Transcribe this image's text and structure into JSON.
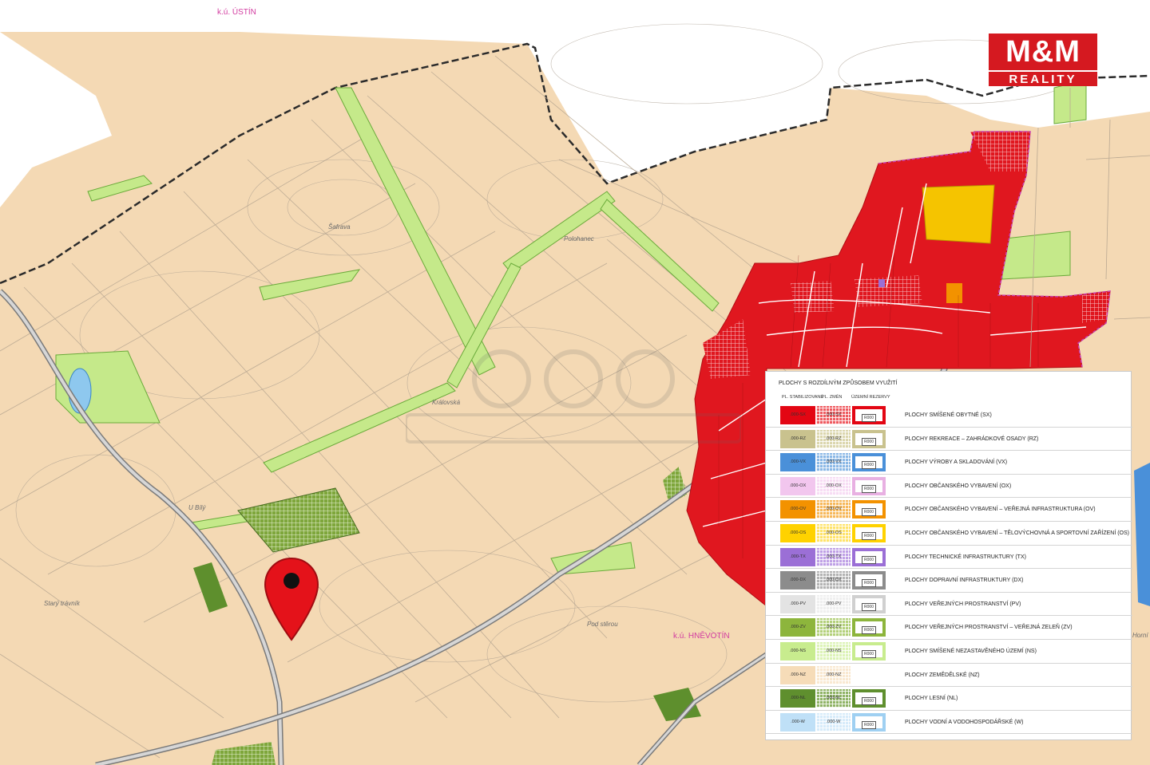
{
  "map": {
    "cadastral_labels": {
      "ustin": "k.ú. ÚSTÍN",
      "hnevotin": "k.ú. HNĚVOTÍN"
    },
    "place_names": {
      "sahrava": "Šafrava",
      "polohanec": "Polohanec",
      "kralovska": "Královská",
      "u_bily": "U Bílý",
      "stary_travnik": "Starý trávník",
      "pod_sterou": "Pod stěrou",
      "horni": "Horní"
    },
    "colors": {
      "agricultural": "#f4d9b4",
      "mixed_residential": "#e0171f",
      "greenery": "#c5e98a",
      "forest": "#5e8f2d",
      "boundary": "#2b2b2b",
      "road": "#8a8a8a"
    }
  },
  "logo": {
    "line1": "M&M",
    "line2": "REALITY",
    "color": "#d51920"
  },
  "marker": {
    "icon": "location-pin-icon",
    "color": "#e4121a"
  },
  "legend": {
    "title": "PLOCHY S ROZDÍLNÝM ZPŮSOBEM VYUŽITÍ",
    "col_stabilized": "PL. STABILIZOVANÉ",
    "col_change": "PL. ZMĚN",
    "col_reserve": "ÚZEMNÍ REZERVY",
    "rows": [
      {
        "code1": ".000-SX",
        "code2": ".000-SX",
        "reserve": "R000",
        "label": "PLOCHY SMÍŠENÉ OBYTNÉ (SX)",
        "color": "#e30613",
        "change_color": "#ef5a5f",
        "border": "#e30613"
      },
      {
        "code1": ".000-RZ",
        "code2": ".000-RZ",
        "reserve": "R000",
        "label": "PLOCHY REKREACE – ZAHRÁDKOVÉ OSADY (RZ)",
        "color": "#c9c28e",
        "change_color": "#dbd6ad",
        "border": "#c9c28e"
      },
      {
        "code1": ".000-VX",
        "code2": ".000-VX",
        "reserve": "R000",
        "label": "PLOCHY VÝROBY A SKLADOVÁNÍ (VX)",
        "color": "#4a90d9",
        "change_color": "#8ab8e6",
        "border": "#4a90d9"
      },
      {
        "code1": ".000-OX",
        "code2": ".000-OX",
        "reserve": "R000",
        "label": "PLOCHY OBČANSKÉHO VYBAVENÍ (OX)",
        "color": "#f2c6ee",
        "change_color": "#f7dcf4",
        "border": "#e8b0e2"
      },
      {
        "code1": ".000-OV",
        "code2": ".000-OV",
        "reserve": "R000",
        "label": "PLOCHY OBČANSKÉHO VYBAVENÍ – VEŘEJNÁ INFRASTRUKTURA (OV)",
        "color": "#f39200",
        "change_color": "#f7b85a",
        "border": "#f39200"
      },
      {
        "code1": ".000-OS",
        "code2": ".000-OS",
        "reserve": "R000",
        "label": "PLOCHY OBČANSKÉHO VYBAVENÍ – TĚLOVÝCHOVNÁ A SPORTOVNÍ ZAŘÍZENÍ (OS)",
        "color": "#ffd200",
        "change_color": "#ffe36a",
        "border": "#ffd200"
      },
      {
        "code1": ".000-TX",
        "code2": ".000-TX",
        "reserve": "R000",
        "label": "PLOCHY TECHNICKÉ INFRASTRUKTURY (TX)",
        "color": "#9b6fd6",
        "change_color": "#bfa0e6",
        "border": "#9b6fd6"
      },
      {
        "code1": ".000-DX",
        "code2": ".000-DX",
        "reserve": "R000",
        "label": "PLOCHY DOPRAVNÍ INFRASTRUKTURY (DX)",
        "color": "#8c8c8c",
        "change_color": "#b3b3b3",
        "border": "#8c8c8c"
      },
      {
        "code1": ".000-PV",
        "code2": ".000-PV",
        "reserve": "R000",
        "label": "PLOCHY VEŘEJNÝCH PROSTRANSTVÍ (PV)",
        "color": "#e3e3e3",
        "change_color": "#efefef",
        "border": "#d0d0d0"
      },
      {
        "code1": ".000-ZV",
        "code2": ".000-ZV",
        "reserve": "R000",
        "label": "PLOCHY VEŘEJNÝCH PROSTRANSTVÍ – VEŘEJNÁ ZELEŇ (ZV)",
        "color": "#8db53c",
        "change_color": "#b3d07a",
        "border": "#8db53c"
      },
      {
        "code1": ".000-NS",
        "code2": ".000-NS",
        "reserve": "R000",
        "label": "PLOCHY SMÍŠENÉ NEZASTAVĚNÉHO ÚZEMÍ (NS)",
        "color": "#c8ec8e",
        "change_color": "#dcf3b6",
        "border": "#c8ec8e"
      },
      {
        "code1": ".000-NZ",
        "code2": ".000-NZ",
        "reserve": "",
        "label": "PLOCHY ZEMĚDĚLSKÉ (NZ)",
        "color": "#f6dcb8",
        "change_color": "#f9e8d0",
        "border": "#ffffff"
      },
      {
        "code1": ".000-NL",
        "code2": ".000-NL",
        "reserve": "R000",
        "label": "PLOCHY LESNÍ (NL)",
        "color": "#5f8f2e",
        "change_color": "#8fb365",
        "border": "#5f8f2e"
      },
      {
        "code1": ".000-W",
        "code2": ".000-W",
        "reserve": "R000",
        "label": "PLOCHY VODNÍ A VODOHOSPODÁŘSKÉ (W)",
        "color": "#bfe0f7",
        "change_color": "#d6ebfa",
        "border": "#9fd0f2"
      }
    ]
  }
}
